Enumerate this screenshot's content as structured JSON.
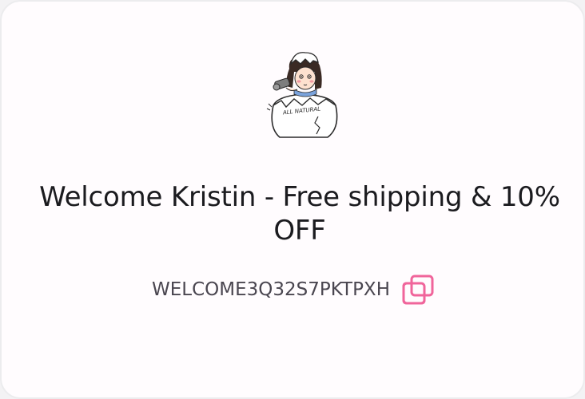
{
  "mascot": {
    "icon": "girl-in-eggshell-illustration-icon",
    "shell_text": "ALL NATURAL"
  },
  "welcome": {
    "title": "Welcome Kristin - Free shipping & 10% OFF"
  },
  "coupon": {
    "code": "WELCOME3Q32S7PKTPXH",
    "copy_icon": "copy-icon"
  },
  "colors": {
    "accent": "#f0659b",
    "text": "#1b1b1f",
    "code_text": "#4a4650",
    "card_background": "#fffcfe"
  }
}
